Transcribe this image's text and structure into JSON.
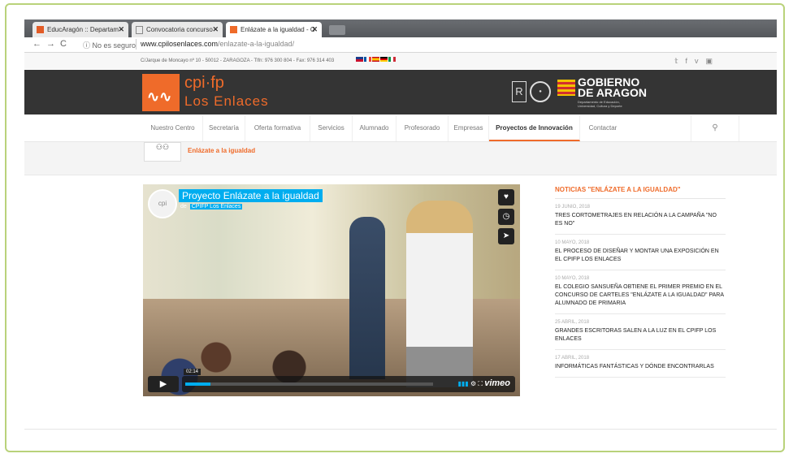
{
  "browser": {
    "tabs": [
      {
        "label": "EducAragón :: Departam",
        "active": false
      },
      {
        "label": "Convocatoria concurso",
        "active": false
      },
      {
        "label": "Enlázate a la igualdad - C",
        "active": true
      }
    ],
    "security": "No es seguro",
    "url_domain": "www.cpilosenlaces.com",
    "url_path": "/enlazate-a-la-igualdad/"
  },
  "topbar": {
    "contact": "C/Jarque de Moncayo nº 10 - 50012 - ZARAGOZA - Tlfn: 976 300 804 - Fax: 976 314 403",
    "social": [
      "twitter-icon",
      "facebook-icon",
      "vimeo-icon",
      "youtube-icon"
    ]
  },
  "header": {
    "logo_line1": "cpi·fp",
    "logo_line2": "Los Enlaces",
    "gov_name": "GOBIERNO DE ARAGON",
    "gov_sub": "Departamento de Educación, Universidad, Cultura y Deporte"
  },
  "menu": [
    "Nuestro Centro",
    "Secretaría",
    "Oferta formativa",
    "Servicios",
    "Alumnado",
    "Profesorado",
    "Empresas",
    "Proyectos de Innovación",
    "Contactar"
  ],
  "menu_active": "Proyectos de Innovación",
  "page": {
    "title": "Enlázate a la igualdad"
  },
  "video": {
    "title": "Proyecto Enlázate a la igualdad",
    "by_prefix": "de",
    "by": "CPIFP Los Enlaces",
    "time": "02:14",
    "provider": "vimeo",
    "progress": 0.1
  },
  "news": {
    "heading": "NOTICIAS \"ENLÁZATE A LA IGUALDAD\"",
    "items": [
      {
        "date": "19 JUNIO, 2018",
        "title": "TRES CORTOMETRAJES EN RELACIÓN A LA CAMPAÑA \"NO ES NO\""
      },
      {
        "date": "10 MAYO, 2018",
        "title": "EL PROCESO DE DISEÑAR Y MONTAR UNA EXPOSICIÓN EN EL CPIFP LOS ENLACES"
      },
      {
        "date": "10 MAYO, 2018",
        "title": "EL COLEGIO SANSUEÑA OBTIENE EL PRIMER PREMIO EN EL CONCURSO DE CARTELES \"ENLÁZATE A LA IGUALDAD\" PARA ALUMNADO DE PRIMARIA"
      },
      {
        "date": "25 ABRIL, 2018",
        "title": "GRANDES ESCRITORAS SALEN A LA LUZ EN EL CPIFP LOS ENLACES"
      },
      {
        "date": "17 ABRIL, 2018",
        "title": "INFORMÁTICAS FANTÁSTICAS Y DÓNDE ENCONTRARLAS"
      }
    ]
  },
  "colors": {
    "accent": "#ef6b2a",
    "header_bg": "#343434",
    "vimeo_blue": "#00adef",
    "frame": "#b9d27a"
  }
}
